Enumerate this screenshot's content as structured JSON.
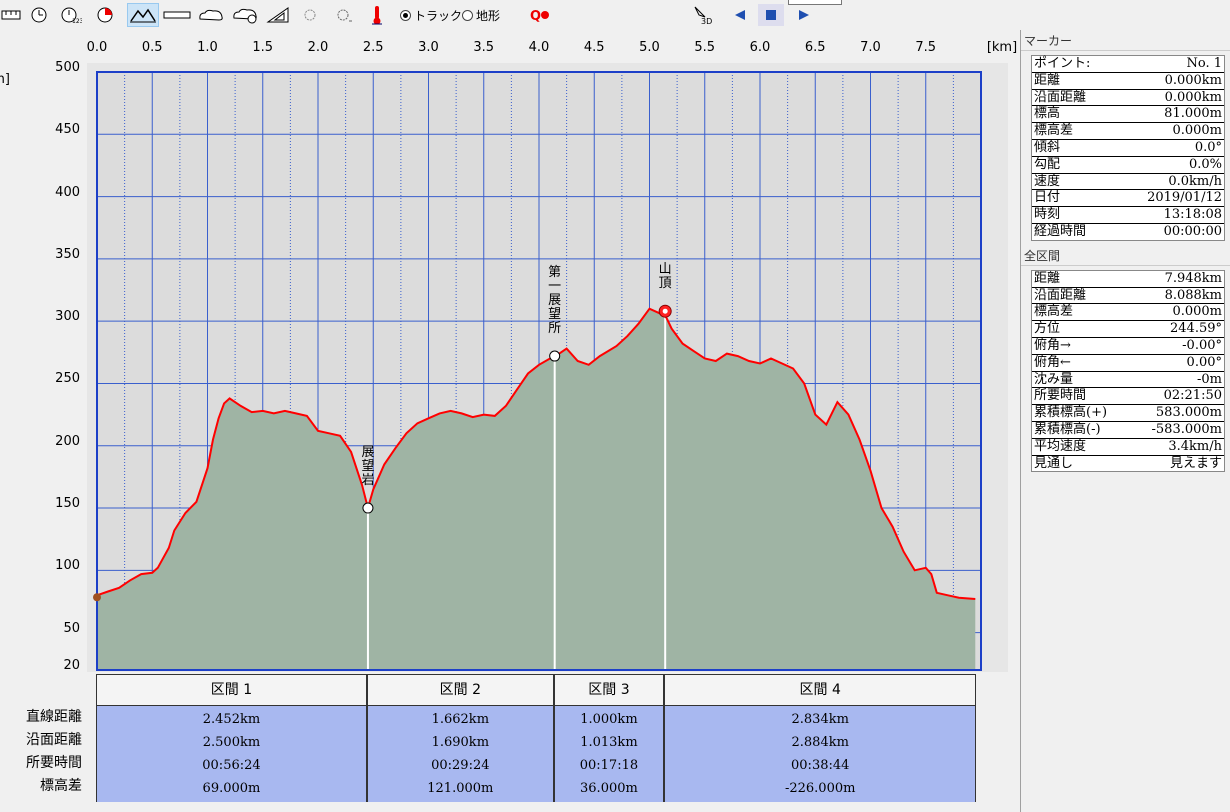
{
  "toolbar": {
    "radio_track": "トラック",
    "radio_terrain": "地形",
    "icons": [
      "ruler-icon",
      "clock-icon",
      "counter-clock-icon",
      "pie-icon",
      "mountain-profile-icon",
      "flat-bar-icon",
      "cloud-icon",
      "cloud-group-icon",
      "triangle-ruler-icon",
      "sun-dim-icon",
      "sun-icon",
      "thermometer-icon",
      "marker-icon",
      "3d-icon",
      "rewind-icon",
      "stop-icon",
      "play-icon"
    ],
    "td_label": "3D"
  },
  "chart_data": {
    "type": "area",
    "xlabel": "[km]",
    "ylabel": "[m]",
    "xlim": [
      0,
      8
    ],
    "ylim": [
      20,
      500
    ],
    "x_ticks": [
      "0.0",
      "0.5",
      "1.0",
      "1.5",
      "2.0",
      "2.5",
      "3.0",
      "3.5",
      "4.0",
      "4.5",
      "5.0",
      "5.5",
      "6.0",
      "6.5",
      "7.0",
      "7.5"
    ],
    "y_ticks": [
      500,
      450,
      400,
      350,
      300,
      250,
      200,
      150,
      100,
      50,
      20
    ],
    "series": [
      {
        "points": [
          [
            0,
            80
          ],
          [
            0.1,
            83
          ],
          [
            0.2,
            86
          ],
          [
            0.3,
            92
          ],
          [
            0.4,
            97
          ],
          [
            0.5,
            98
          ],
          [
            0.55,
            102
          ],
          [
            0.65,
            118
          ],
          [
            0.7,
            132
          ],
          [
            0.8,
            146
          ],
          [
            0.9,
            155
          ],
          [
            1.0,
            182
          ],
          [
            1.05,
            205
          ],
          [
            1.1,
            222
          ],
          [
            1.15,
            234
          ],
          [
            1.2,
            238
          ],
          [
            1.3,
            232
          ],
          [
            1.4,
            227
          ],
          [
            1.5,
            228
          ],
          [
            1.6,
            226
          ],
          [
            1.7,
            228
          ],
          [
            1.8,
            226
          ],
          [
            1.9,
            224
          ],
          [
            2.0,
            212
          ],
          [
            2.1,
            210
          ],
          [
            2.2,
            208
          ],
          [
            2.3,
            195
          ],
          [
            2.4,
            168
          ],
          [
            2.452,
            150
          ],
          [
            2.5,
            165
          ],
          [
            2.6,
            185
          ],
          [
            2.7,
            198
          ],
          [
            2.8,
            210
          ],
          [
            2.9,
            218
          ],
          [
            3.0,
            222
          ],
          [
            3.1,
            226
          ],
          [
            3.2,
            228
          ],
          [
            3.3,
            226
          ],
          [
            3.4,
            223
          ],
          [
            3.5,
            225
          ],
          [
            3.6,
            224
          ],
          [
            3.7,
            232
          ],
          [
            3.8,
            245
          ],
          [
            3.9,
            258
          ],
          [
            4.0,
            265
          ],
          [
            4.1,
            270
          ],
          [
            4.15,
            272
          ],
          [
            4.25,
            278
          ],
          [
            4.35,
            268
          ],
          [
            4.45,
            265
          ],
          [
            4.55,
            272
          ],
          [
            4.7,
            280
          ],
          [
            4.8,
            288
          ],
          [
            4.9,
            298
          ],
          [
            5.0,
            310
          ],
          [
            5.1,
            306
          ],
          [
            5.114,
            310
          ],
          [
            5.2,
            294
          ],
          [
            5.3,
            282
          ],
          [
            5.4,
            276
          ],
          [
            5.5,
            270
          ],
          [
            5.6,
            268
          ],
          [
            5.7,
            274
          ],
          [
            5.8,
            272
          ],
          [
            5.9,
            268
          ],
          [
            6.0,
            266
          ],
          [
            6.1,
            270
          ],
          [
            6.2,
            266
          ],
          [
            6.3,
            262
          ],
          [
            6.4,
            250
          ],
          [
            6.5,
            225
          ],
          [
            6.6,
            217
          ],
          [
            6.7,
            235
          ],
          [
            6.8,
            225
          ],
          [
            6.9,
            205
          ],
          [
            7.0,
            180
          ],
          [
            7.1,
            150
          ],
          [
            7.2,
            135
          ],
          [
            7.3,
            115
          ],
          [
            7.4,
            100
          ],
          [
            7.5,
            102
          ],
          [
            7.55,
            97
          ],
          [
            7.6,
            82
          ],
          [
            7.7,
            80
          ],
          [
            7.8,
            78
          ],
          [
            7.948,
            77
          ]
        ]
      }
    ],
    "markers": [
      {
        "label": "展望岩",
        "x": 2.452,
        "y": 150
      },
      {
        "label": "第一展望所",
        "x": 4.142,
        "y": 272
      },
      {
        "label": "山頂",
        "x": 5.142,
        "y": 308
      }
    ],
    "grid": true
  },
  "segments": {
    "headers": [
      "区間 1",
      "区間 2",
      "区間 3",
      "区間 4"
    ],
    "row_labels": [
      "直線距離",
      "沿面距離",
      "所要時間",
      "標高差"
    ],
    "rows": [
      [
        "2.452km",
        "1.662km",
        "1.000km",
        "2.834km"
      ],
      [
        "2.500km",
        "1.690km",
        "1.013km",
        "2.884km"
      ],
      [
        "00:56:24",
        "00:29:24",
        "00:17:18",
        "00:38:44"
      ],
      [
        "69.000m",
        "121.000m",
        "36.000m",
        "-226.000m"
      ]
    ]
  },
  "marker_panel": {
    "title": "マーカー",
    "items": [
      {
        "label": "ポイント:",
        "value": "No. 1"
      },
      {
        "label": "距離",
        "value": "0.000km"
      },
      {
        "label": "沿面距離",
        "value": "0.000km"
      },
      {
        "label": "標高",
        "value": "81.000m"
      },
      {
        "label": "標高差",
        "value": "0.000m"
      },
      {
        "label": "傾斜",
        "value": "0.0°"
      },
      {
        "label": "勾配",
        "value": "0.0%"
      },
      {
        "label": "速度",
        "value": "0.0km/h"
      },
      {
        "label": "日付",
        "value": "2019/01/12"
      },
      {
        "label": "時刻",
        "value": "13:18:08"
      },
      {
        "label": "経過時間",
        "value": "00:00:00"
      }
    ]
  },
  "total_panel": {
    "title": "全区間",
    "items": [
      {
        "label": "距離",
        "value": "7.948km"
      },
      {
        "label": "沿面距離",
        "value": "8.088km"
      },
      {
        "label": "標高差",
        "value": "0.000m"
      },
      {
        "label": "方位",
        "value": "244.59°"
      },
      {
        "label": "俯角→",
        "value": "-0.00°"
      },
      {
        "label": "俯角←",
        "value": "0.00°"
      },
      {
        "label": "沈み量",
        "value": "-0m"
      },
      {
        "label": "所要時間",
        "value": "02:21:50"
      },
      {
        "label": "累積標高(+)",
        "value": "583.000m"
      },
      {
        "label": "累積標高(-)",
        "value": "-583.000m"
      },
      {
        "label": "平均速度",
        "value": "3.4km/h"
      },
      {
        "label": "見通し",
        "value": "見えます"
      }
    ]
  },
  "colors": {
    "plot_bg": "#dcdcdc",
    "grid": "#3a5fcd",
    "fill": "#9fb4a4",
    "line": "#ff0000",
    "table_body": "#a8b8f0"
  }
}
